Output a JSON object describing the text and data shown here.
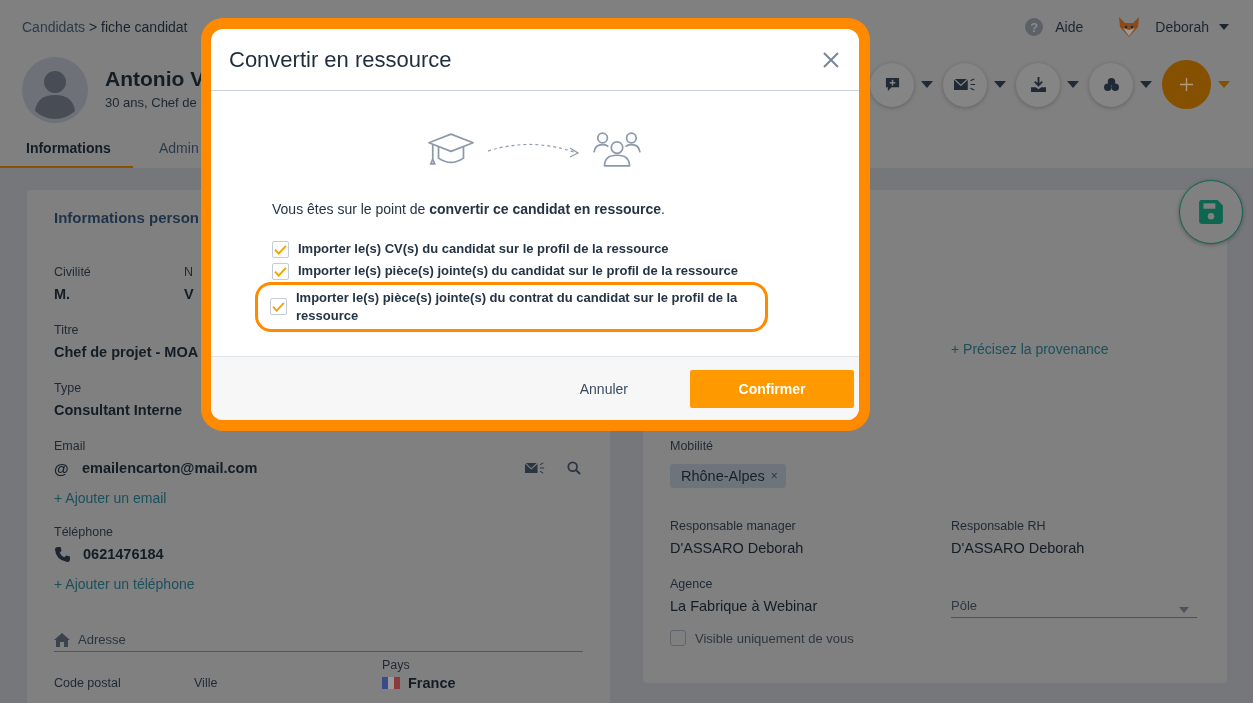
{
  "header": {
    "crumbs": [
      "Candidats",
      "> fiche candidat"
    ],
    "help_glyph": "?",
    "help": "Aide",
    "user": "Deborah"
  },
  "profile": {
    "name": "Antonio V",
    "subtitle": "30 ans, Chef de"
  },
  "actions": [
    {
      "kind": "comment"
    },
    {
      "kind": "mail"
    },
    {
      "kind": "download"
    },
    {
      "kind": "cubes"
    },
    {
      "kind": "add"
    }
  ],
  "tabs": [
    {
      "label": "Informations",
      "selected": true
    },
    {
      "label": "Admin",
      "selected": false
    }
  ],
  "personal": {
    "title": "Informations person",
    "civility": {
      "label": "Civilité",
      "value": "M."
    },
    "name_col": {
      "label": "N",
      "value": "V"
    },
    "title_field": {
      "label": "Titre",
      "value": "Chef de projet - MOA"
    },
    "type_field": {
      "label": "Type",
      "value": "Consultant Interne"
    },
    "email": {
      "label": "Email",
      "value": "emailencarton@mail.com",
      "at": "@",
      "add": "+ Ajouter un email"
    },
    "phone": {
      "label": "Téléphone",
      "value": "0621476184",
      "add": "+ Ajouter un téléphone"
    },
    "address": {
      "title": "Adresse",
      "country_label": "Pays",
      "postal_label": "Code postal",
      "city_label": "Ville",
      "country": "France"
    }
  },
  "details": {
    "provenance": "+ Précisez la provenance",
    "mobility": {
      "label": "Mobilité",
      "chips": [
        {
          "label": "Rhône-Alpes",
          "remove": "×"
        }
      ]
    },
    "manager": {
      "label": "Responsable manager",
      "value": "D'ASSARO Deborah"
    },
    "hr": {
      "label": "Responsable RH",
      "value": "D'ASSARO Deborah"
    },
    "agency": {
      "label": "Agence",
      "value": "La Fabrique à Webinar"
    },
    "pole": {
      "placeholder": "Pôle"
    },
    "visible": {
      "label": "Visible uniquement de vous",
      "checked": false
    }
  },
  "dialog": {
    "title": "Convertir en ressource",
    "message": "Vous êtes sur le point de **convertir ce candidat en ressource**.",
    "options": [
      {
        "label": "Importer le(s) CV(s) du candidat sur le profil de la ressource",
        "checked": true,
        "highlighted": false
      },
      {
        "label": "Importer le(s) pièce(s) jointe(s) du candidat sur le profil de la ressource",
        "checked": true,
        "highlighted": false
      },
      {
        "label": "Importer le(s) pièce(s) jointe(s) du contrat du candidat sur le profil de la ressource",
        "checked": true,
        "highlighted": true
      }
    ],
    "buttons": [
      {
        "label": "Annuler",
        "kind": "secondary"
      },
      {
        "label": "Confirmer",
        "kind": "primary"
      }
    ]
  }
}
